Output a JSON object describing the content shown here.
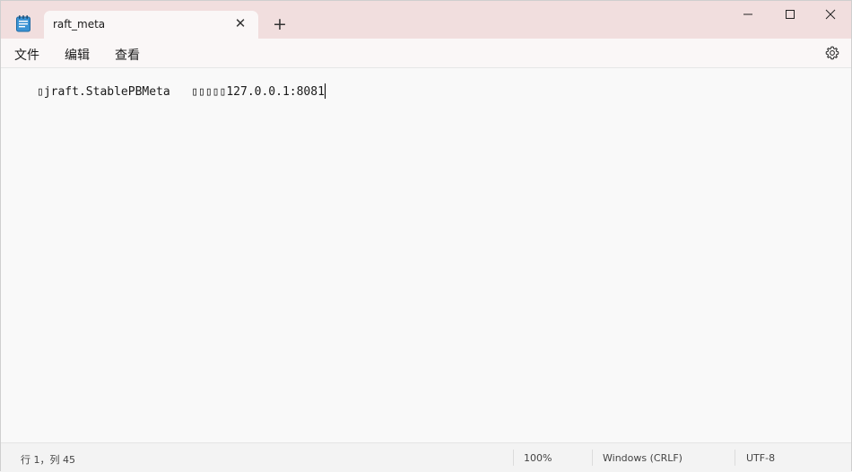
{
  "tab": {
    "title": "raft_meta",
    "close_icon": "close-icon",
    "new_tab_icon": "plus-icon"
  },
  "window_controls": {
    "minimize_icon": "minimize-icon",
    "maximize_icon": "maximize-icon",
    "close_icon": "close-icon"
  },
  "menu": {
    "items": [
      "文件",
      "编辑",
      "查看"
    ],
    "settings_icon": "gear-icon"
  },
  "editor": {
    "content_prefix": "jraft.StablePBMeta   ",
    "content_suffix": "127.0.0.1:8081"
  },
  "status": {
    "position": "行 1，列 45",
    "zoom": "100%",
    "line_ending": "Windows (CRLF)",
    "encoding": "UTF-8"
  },
  "colors": {
    "titlebar": "#f1dede",
    "tab": "#faf7f7",
    "editor_bg": "#f9f9f9",
    "notepad_icon": "#2f87c8"
  }
}
